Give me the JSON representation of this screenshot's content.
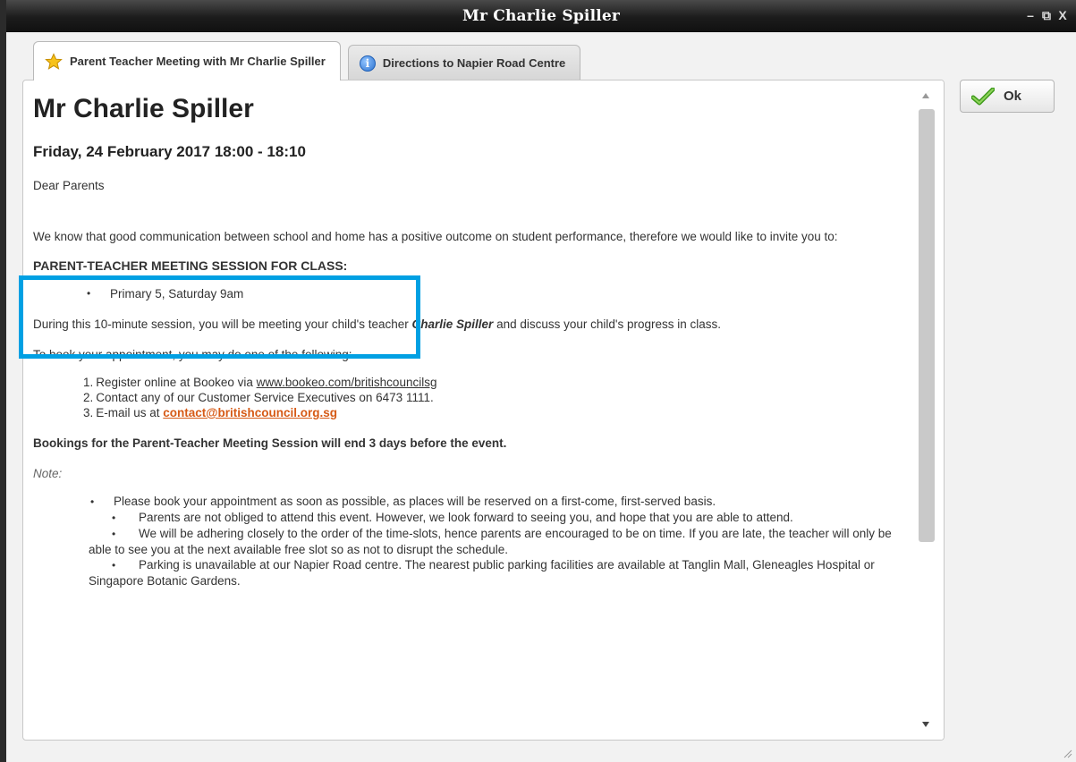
{
  "window": {
    "title": "Mr Charlie Spiller",
    "controls": {
      "minimize": "–",
      "restore": "⧉",
      "close": "X"
    }
  },
  "tabs": [
    {
      "label": "Parent Teacher Meeting with Mr Charlie Spiller",
      "icon": "star-icon",
      "active": true
    },
    {
      "label": "Directions to Napier Road Centre",
      "icon": "info-icon",
      "active": false
    }
  ],
  "ok_button": {
    "label": "Ok",
    "icon": "check-icon"
  },
  "document": {
    "heading": "Mr Charlie Spiller",
    "datetime": "Friday, 24 February 2017 18:00 - 18:10",
    "salutation": "Dear Parents",
    "intro": "We know that good communication between school and home has a positive outcome on student performance, therefore we would like to invite you to:",
    "session_heading": "PARENT-TEACHER MEETING SESSION FOR CLASS:",
    "session_items": [
      "Primary 5, Saturday 9am"
    ],
    "during_pre": "During this 10-minute session, you will be meeting your child's teacher ",
    "teacher_name": "Charlie Spiller",
    "during_post": " and discuss your child's progress in class.",
    "to_book": "To book your appointment, you may do one of the following:",
    "steps": {
      "one_pre": "Register online at Bookeo via ",
      "one_link": "www.bookeo.com/britishcouncilsg",
      "two": "Contact any of our Customer Service Executives on 6473 1111.",
      "three_pre": "E-mail us at ",
      "three_link": "contact@britishcouncil.org.sg"
    },
    "bookings": "Bookings for the Parent-Teacher Meeting Session will end 3 days before the event.",
    "note_label": "Note:",
    "notes": [
      "Please book your appointment as soon as possible, as places will be reserved on a first-come, first-served basis.",
      "Parents are not obliged to attend this event. However, we look forward to seeing you, and hope that you are able to attend.",
      "We will be adhering closely to the order of the time-slots, hence parents are encouraged to be on time. If you are late, the teacher will only be able to see you at the next available free slot so as not to disrupt the schedule.",
      "Parking is unavailable at our Napier Road centre. The nearest public parking facilities are available at Tanglin Mall, Gleneagles Hospital or Singapore Botanic Gardens."
    ]
  },
  "colors": {
    "highlight_border": "#00a0e3",
    "email_link": "#d65a16",
    "titlebar": "#1c1c1c"
  }
}
